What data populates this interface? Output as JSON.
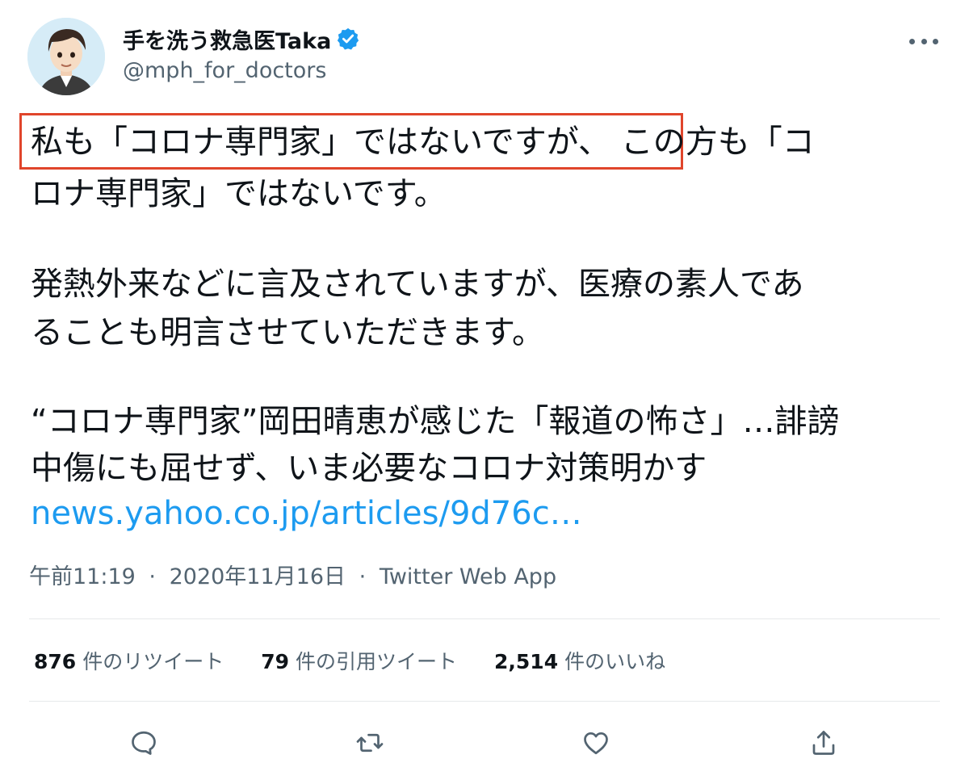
{
  "author": {
    "display_name": "手を洗う救急医Taka",
    "handle": "@mph_for_doctors",
    "verified": true
  },
  "tweet": {
    "lines": [
      "私も「コロナ専門家」ではないですが、 この方も「コ",
      "ロナ専門家」ではないです。",
      "発熱外来などに言及されていますが、医療の素人であ",
      "ることも明言させていただきます。",
      "“コロナ専門家”岡田晴恵が感じた「報道の怖さ」…誹謗",
      "中傷にも屈せず、いま必要なコロナ対策明かす"
    ],
    "link": "news.yahoo.co.jp/articles/9d76c…",
    "highlight_color": "#e0452b"
  },
  "meta": {
    "time": "午前11:19",
    "date": "2020年11月16日",
    "source": "Twitter Web App",
    "separator": "·"
  },
  "stats": {
    "retweets": {
      "count": "876",
      "label": "件のリツイート"
    },
    "quotes": {
      "count": "79",
      "label": "件の引用ツイート"
    },
    "likes": {
      "count": "2,514",
      "label": "件のいいね"
    }
  },
  "actions": {
    "icons": [
      "reply-icon",
      "retweet-icon",
      "like-icon",
      "share-icon"
    ]
  },
  "colors": {
    "text": "#0f1419",
    "secondary": "#536471",
    "link": "#1d9bf0",
    "verified": "#1d9bf0",
    "divider": "#e7e9ea"
  }
}
